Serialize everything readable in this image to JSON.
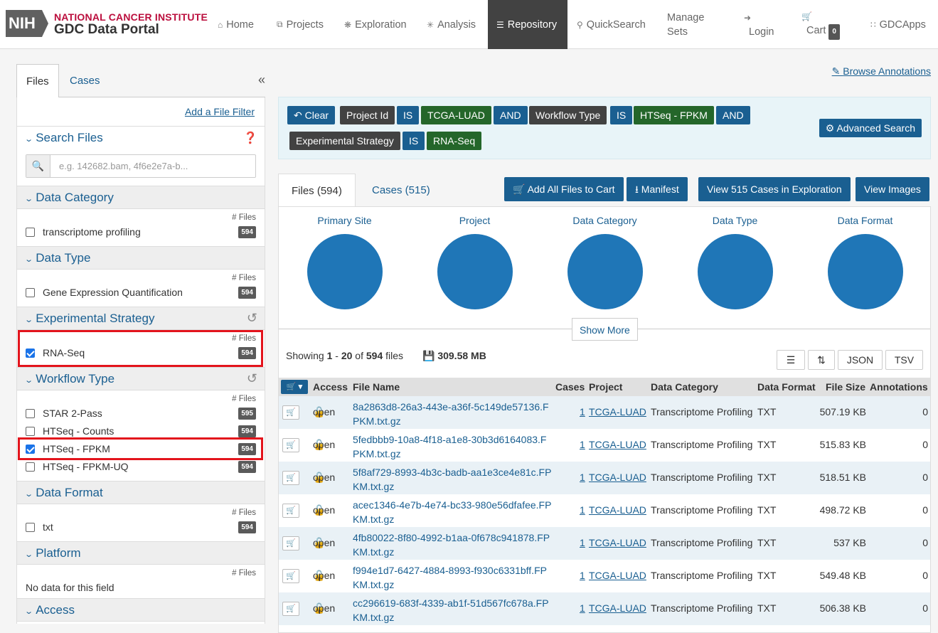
{
  "header": {
    "nih": "NIH",
    "nci": "NATIONAL CANCER INSTITUTE",
    "portal": "GDC Data Portal",
    "nav": {
      "home": "Home",
      "projects": "Projects",
      "exploration": "Exploration",
      "analysis": "Analysis",
      "repository": "Repository",
      "quick1": "Quick",
      "quick2": "Search",
      "manage1": "Manage",
      "manage2": "Sets",
      "login": "Login",
      "cart": "Cart",
      "cart_count": "0",
      "apps1": "GDC",
      "apps2": "Apps"
    }
  },
  "sidebar": {
    "tab_files": "Files",
    "tab_cases": "Cases",
    "collapse": "«",
    "add_filter": "Add a File Filter",
    "search_title": "Search Files",
    "search_placeholder": "e.g. 142682.bam, 4f6e2e7a-b...",
    "nfiles": "# Files",
    "facets": [
      {
        "title": "Data Category",
        "items": [
          {
            "label": "transcriptome profiling",
            "count": "594",
            "checked": false
          }
        ]
      },
      {
        "title": "Data Type",
        "items": [
          {
            "label": "Gene Expression Quantification",
            "count": "594",
            "checked": false
          }
        ]
      },
      {
        "title": "Experimental Strategy",
        "items": [
          {
            "label": "RNA-Seq",
            "count": "594",
            "checked": true
          }
        ]
      },
      {
        "title": "Workflow Type",
        "items": [
          {
            "label": "STAR 2-Pass",
            "count": "595",
            "checked": false
          },
          {
            "label": "HTSeq - Counts",
            "count": "594",
            "checked": false
          },
          {
            "label": "HTSeq - FPKM",
            "count": "594",
            "checked": true
          },
          {
            "label": "HTSeq - FPKM-UQ",
            "count": "594",
            "checked": false
          }
        ]
      },
      {
        "title": "Data Format",
        "items": [
          {
            "label": "txt",
            "count": "594",
            "checked": false
          }
        ]
      },
      {
        "title": "Platform",
        "empty": "No data for this field"
      },
      {
        "title": "Access"
      }
    ]
  },
  "main": {
    "browse_annotations": "Browse Annotations",
    "query": {
      "clear": "Clear",
      "project_id": "Project Id",
      "is1": "IS",
      "tcga_luad": "TCGA-LUAD",
      "and1": "AND",
      "workflow_type": "Workflow Type",
      "is2": "IS",
      "htseq_fpkm": "HTSeq - FPKM",
      "and2": "AND",
      "exp_strategy": "Experimental Strategy",
      "is3": "IS",
      "rna_seq": "RNA-Seq",
      "advanced": "Advanced Search"
    },
    "tabs": {
      "files": "Files (594)",
      "cases": "Cases (515)"
    },
    "actions": {
      "add_all": "Add All Files to Cart",
      "manifest": "Manifest",
      "view_cases": "View 515 Cases in Exploration",
      "view_images": "View Images"
    },
    "pies": [
      "Primary Site",
      "Project",
      "Data Category",
      "Data Type",
      "Data Format"
    ],
    "show_more": "Show More",
    "showing": {
      "prefix": "Showing ",
      "from": "1",
      "dash": " - ",
      "to": "20",
      "of": " of ",
      "total": "594",
      "suffix": " files",
      "size": "309.58 MB"
    },
    "table_buttons": {
      "json": "JSON",
      "tsv": "TSV"
    },
    "columns": {
      "access": "Access",
      "file_name": "File Name",
      "cases": "Cases",
      "project": "Project",
      "data_category": "Data Category",
      "data_format": "Data Format",
      "file_size": "File Size",
      "annotations": "Annotations"
    },
    "rows": [
      {
        "access": "open",
        "name1": "8a2863d8-26a3-443e-a36f-5c149de57136.F",
        "name2": "PKM.txt.gz",
        "cases": "1",
        "project": "TCGA-LUAD",
        "category": "Transcriptome Profiling",
        "format": "TXT",
        "size": "507.19 KB",
        "ann": "0"
      },
      {
        "access": "open",
        "name1": "5fedbbb9-10a8-4f18-a1e8-30b3d6164083.F",
        "name2": "PKM.txt.gz",
        "cases": "1",
        "project": "TCGA-LUAD",
        "category": "Transcriptome Profiling",
        "format": "TXT",
        "size": "515.83 KB",
        "ann": "0"
      },
      {
        "access": "open",
        "name1": "5f8af729-8993-4b3c-badb-aa1e3ce4e81c.FP",
        "name2": "KM.txt.gz",
        "cases": "1",
        "project": "TCGA-LUAD",
        "category": "Transcriptome Profiling",
        "format": "TXT",
        "size": "518.51 KB",
        "ann": "0"
      },
      {
        "access": "open",
        "name1": "acec1346-4e7b-4e74-bc33-980e56dfafee.FP",
        "name2": "KM.txt.gz",
        "cases": "1",
        "project": "TCGA-LUAD",
        "category": "Transcriptome Profiling",
        "format": "TXT",
        "size": "498.72 KB",
        "ann": "0"
      },
      {
        "access": "open",
        "name1": "4fb80022-8f80-4992-b1aa-0f678c941878.FP",
        "name2": "KM.txt.gz",
        "cases": "1",
        "project": "TCGA-LUAD",
        "category": "Transcriptome Profiling",
        "format": "TXT",
        "size": "537 KB",
        "ann": "0"
      },
      {
        "access": "open",
        "name1": "f994e1d7-6427-4884-8993-f930c6331bff.FP",
        "name2": "KM.txt.gz",
        "cases": "1",
        "project": "TCGA-LUAD",
        "category": "Transcriptome Profiling",
        "format": "TXT",
        "size": "549.48 KB",
        "ann": "0"
      },
      {
        "access": "open",
        "name1": "cc296619-683f-4339-ab1f-51d567fc678a.FP",
        "name2": "KM.txt.gz",
        "cases": "1",
        "project": "TCGA-LUAD",
        "category": "Transcriptome Profiling",
        "format": "TXT",
        "size": "506.38 KB",
        "ann": "0"
      }
    ]
  }
}
